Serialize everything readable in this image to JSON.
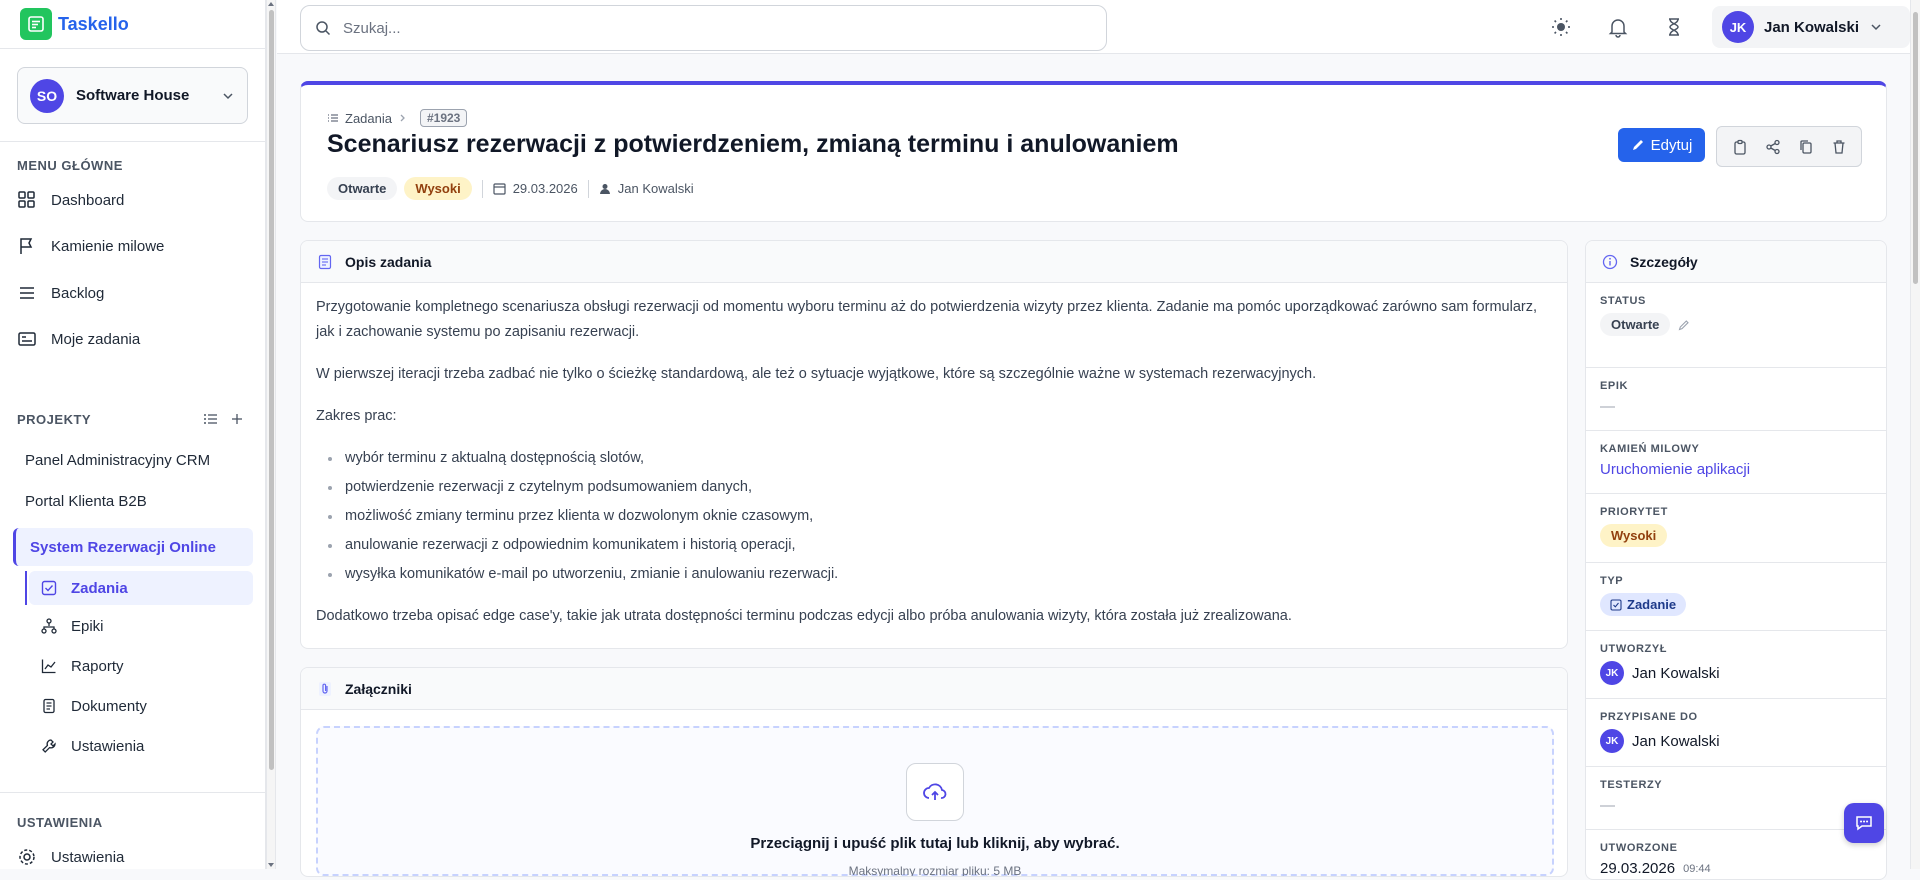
{
  "app": {
    "name": "Taskello"
  },
  "workspace": {
    "initials": "SO",
    "name": "Software House"
  },
  "sidebar": {
    "main_menu_title": "MENU GŁÓWNE",
    "main_menu": [
      {
        "label": "Dashboard",
        "icon": "dashboard-icon"
      },
      {
        "label": "Kamienie milowe",
        "icon": "flag-icon"
      },
      {
        "label": "Backlog",
        "icon": "list-icon"
      },
      {
        "label": "Moje zadania",
        "icon": "id-card-icon"
      }
    ],
    "projects_title": "PROJEKTY",
    "projects": [
      "Panel Administracyjny CRM",
      "Portal Klienta B2B",
      "System Rezerwacji Online"
    ],
    "active_project_subnav": [
      {
        "label": "Zadania",
        "icon": "checkbox-icon",
        "active": true
      },
      {
        "label": "Epiki",
        "icon": "hierarchy-icon"
      },
      {
        "label": "Raporty",
        "icon": "chart-line-icon"
      },
      {
        "label": "Dokumenty",
        "icon": "document-icon"
      },
      {
        "label": "Ustawienia",
        "icon": "wrench-icon"
      }
    ],
    "settings_title": "USTAWIENIA",
    "settings": [
      {
        "label": "Ustawienia",
        "icon": "gear-icon"
      }
    ]
  },
  "topbar": {
    "search_placeholder": "Szukaj...",
    "user": {
      "initials": "JK",
      "name": "Jan Kowalski"
    }
  },
  "task": {
    "breadcrumb": "Zadania",
    "id": "#1923",
    "title": "Scenariusz rezerwacji z potwierdzeniem, zmianą terminu i anulowaniem",
    "status": "Otwarte",
    "priority": "Wysoki",
    "date": "29.03.2026",
    "author": "Jan Kowalski",
    "edit_label": "Edytuj"
  },
  "description": {
    "title": "Opis zadania",
    "p1": "Przygotowanie kompletnego scenariusza obsługi rezerwacji od momentu wyboru terminu aż do potwierdzenia wizyty przez klienta. Zadanie ma pomóc uporządkować zarówno sam formularz, jak i zachowanie systemu po zapisaniu rezerwacji.",
    "p2": "W pierwszej iteracji trzeba zadbać nie tylko o ścieżkę standardową, ale też o sytuacje wyjątkowe, które są szczególnie ważne w systemach rezerwacyjnych.",
    "p3": "Zakres prac:",
    "items": [
      "wybór terminu z aktualną dostępnością slotów,",
      "potwierdzenie rezerwacji z czytelnym podsumowaniem danych,",
      "możliwość zmiany terminu przez klienta w dozwolonym oknie czasowym,",
      "anulowanie rezerwacji z odpowiednim komunikatem i historią operacji,",
      "wysyłka komunikatów e-mail po utworzeniu, zmianie i anulowaniu rezerwacji."
    ],
    "p4": "Dodatkowo trzeba opisać edge case'y, takie jak utrata dostępności terminu podczas edycji albo próba anulowania wizyty, która została już zrealizowana."
  },
  "attachments": {
    "title": "Załączniki",
    "drop_text": "Przeciągnij i upuść plik tutaj lub kliknij, aby wybrać.",
    "drop_sub": "Maksymalny rozmiar pliku: 5 MB"
  },
  "details": {
    "title": "Szczegóły",
    "status_label": "STATUS",
    "status": "Otwarte",
    "epic_label": "EPIK",
    "epic": "—",
    "milestone_label": "KAMIEŃ MILOWY",
    "milestone": "Uruchomienie aplikacji",
    "priority_label": "PRIORYTET",
    "priority": "Wysoki",
    "type_label": "TYP",
    "type": "Zadanie",
    "created_by_label": "UTWORZYŁ",
    "created_by": "Jan Kowalski",
    "created_by_initials": "JK",
    "assigned_label": "PRZYPISANE DO",
    "assigned": "Jan Kowalski",
    "assigned_initials": "JK",
    "testers_label": "TESTERZY",
    "testers": "—",
    "created_label": "UTWORZONE",
    "created_date": "29.03.2026",
    "created_time": "09:44"
  },
  "colors": {
    "accent": "#4f46e5",
    "primary_button": "#2563eb",
    "logo": "#22c55e",
    "priority_bg": "#fef3c7"
  }
}
